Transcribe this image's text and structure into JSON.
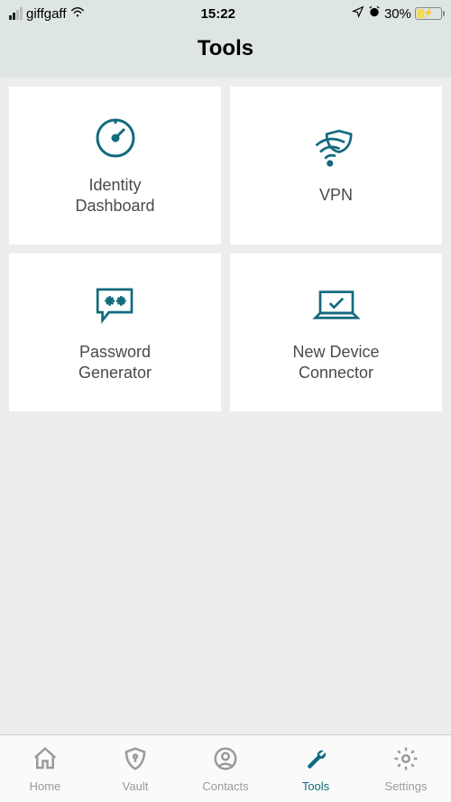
{
  "status": {
    "carrier": "giffgaff",
    "time": "15:22",
    "battery_pct": "30%"
  },
  "header": {
    "title": "Tools"
  },
  "tiles": [
    {
      "label": "Identity\nDashboard",
      "icon": "dashboard"
    },
    {
      "label": "VPN",
      "icon": "vpn"
    },
    {
      "label": "Password\nGenerator",
      "icon": "password"
    },
    {
      "label": "New Device\nConnector",
      "icon": "device"
    }
  ],
  "tabs": [
    {
      "label": "Home",
      "icon": "home",
      "active": false
    },
    {
      "label": "Vault",
      "icon": "vault",
      "active": false
    },
    {
      "label": "Contacts",
      "icon": "contacts",
      "active": false
    },
    {
      "label": "Tools",
      "icon": "tools",
      "active": true
    },
    {
      "label": "Settings",
      "icon": "settings",
      "active": false
    }
  ],
  "colors": {
    "accent": "#136a7e"
  }
}
